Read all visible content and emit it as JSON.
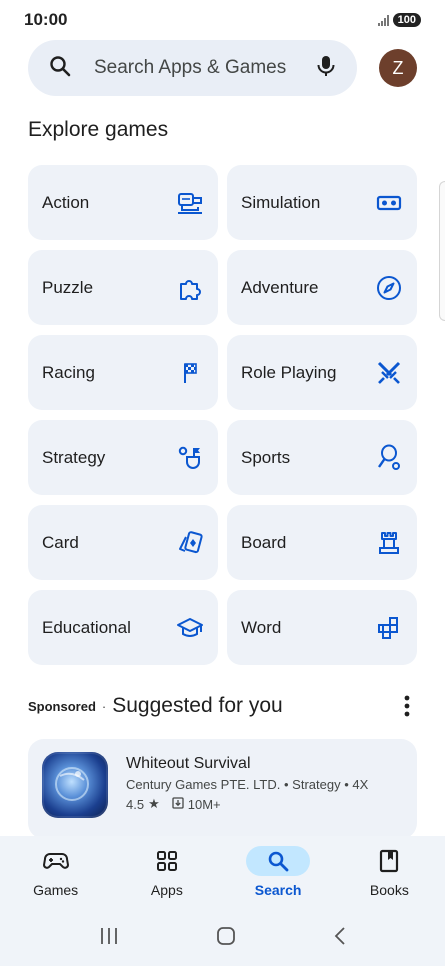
{
  "status_bar": {
    "time": "10:00",
    "battery": "100"
  },
  "search": {
    "placeholder": "Search Apps & Games",
    "avatar_letter": "Z"
  },
  "explore": {
    "title": "Explore games",
    "categories": [
      {
        "label": "Action",
        "icon": "action-icon"
      },
      {
        "label": "Simulation",
        "icon": "simulation-icon"
      },
      {
        "label": "Puzzle",
        "icon": "puzzle-icon"
      },
      {
        "label": "Adventure",
        "icon": "compass-icon"
      },
      {
        "label": "Racing",
        "icon": "flag-icon"
      },
      {
        "label": "Role Playing",
        "icon": "swords-icon"
      },
      {
        "label": "Strategy",
        "icon": "strategy-icon"
      },
      {
        "label": "Sports",
        "icon": "racket-icon"
      },
      {
        "label": "Card",
        "icon": "cards-icon"
      },
      {
        "label": "Board",
        "icon": "rook-icon"
      },
      {
        "label": "Educational",
        "icon": "graduation-cap-icon"
      },
      {
        "label": "Word",
        "icon": "word-blocks-icon"
      }
    ]
  },
  "suggested": {
    "sponsored_label": "Sponsored",
    "separator": "·",
    "title": "Suggested for you",
    "app": {
      "name": "Whiteout Survival",
      "developer": "Century Games PTE. LTD.",
      "category": "Strategy",
      "tag": "4X",
      "meta_separator": "•",
      "rating": "4.5",
      "rating_star": "★",
      "downloads": "10M+"
    }
  },
  "bottom_nav": {
    "items": [
      {
        "label": "Games",
        "icon": "gamepad-icon",
        "active": false
      },
      {
        "label": "Apps",
        "icon": "apps-grid-icon",
        "active": false
      },
      {
        "label": "Search",
        "icon": "search-icon",
        "active": true
      },
      {
        "label": "Books",
        "icon": "book-icon",
        "active": false
      }
    ]
  },
  "colors": {
    "accent": "#0b57d0",
    "tile_bg": "#eef2f8",
    "search_bg": "#e9eef6",
    "active_pill": "#c2e7ff"
  }
}
